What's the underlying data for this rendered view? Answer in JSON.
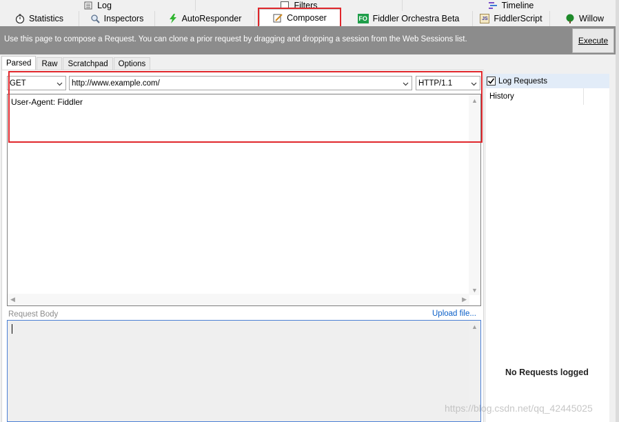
{
  "tabs_row1": [
    {
      "label": "Log",
      "icon": "log-icon"
    },
    {
      "label": "Filters",
      "icon": "filters-checkbox-icon"
    },
    {
      "label": "Timeline",
      "icon": "timeline-icon"
    }
  ],
  "tabs_row2": [
    {
      "label": "Statistics",
      "icon": "stopwatch-icon"
    },
    {
      "label": "Inspectors",
      "icon": "magnifier-icon"
    },
    {
      "label": "AutoResponder",
      "icon": "lightning-icon"
    },
    {
      "label": "Composer",
      "icon": "compose-icon"
    },
    {
      "label": "Fiddler Orchestra Beta",
      "icon": "fo-icon",
      "icon_text": "FO"
    },
    {
      "label": "FiddlerScript",
      "icon": "script-icon",
      "icon_text": "JS"
    },
    {
      "label": "Willow",
      "icon": "tree-icon"
    }
  ],
  "banner": {
    "message": "Use this page to compose a Request. You can clone a prior request by dragging and dropping a session from the Web Sessions list.",
    "execute_label": "Execute"
  },
  "subtabs": [
    "Parsed",
    "Raw",
    "Scratchpad",
    "Options"
  ],
  "request": {
    "method": "GET",
    "url": "http://www.example.com/",
    "version": "HTTP/1.1",
    "headers": "User-Agent: Fiddler",
    "body_label": "Request Body",
    "upload_label": "Upload file..."
  },
  "right_panel": {
    "log_requests_label": "Log Requests",
    "log_requests_checked": true,
    "history_header": "History",
    "empty_message": "No Requests logged"
  },
  "watermark": "https://blog.csdn.net/qq_42445025",
  "colors": {
    "highlight": "#e0262b",
    "banner": "#8c8c8c",
    "link": "#0a5fc8"
  }
}
